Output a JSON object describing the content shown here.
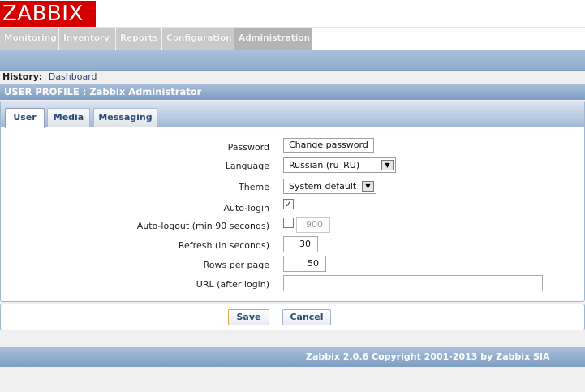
{
  "logo": "ZABBIX",
  "menu": [
    {
      "label": "Monitoring",
      "active": false
    },
    {
      "label": "Inventory",
      "active": false
    },
    {
      "label": "Reports",
      "active": false
    },
    {
      "label": "Configuration",
      "active": false
    },
    {
      "label": "Administration",
      "active": true
    }
  ],
  "history": {
    "label": "History:",
    "link": "Dashboard"
  },
  "page_header": "USER PROFILE : Zabbix Administrator",
  "tabs": [
    {
      "label": "User",
      "active": true
    },
    {
      "label": "Media",
      "active": false
    },
    {
      "label": "Messaging",
      "active": false
    }
  ],
  "form": {
    "password": {
      "label": "Password",
      "button": "Change password"
    },
    "language": {
      "label": "Language",
      "value": "Russian (ru_RU)"
    },
    "theme": {
      "label": "Theme",
      "value": "System default"
    },
    "autologin": {
      "label": "Auto-login",
      "checked": true,
      "mark": "✓"
    },
    "autologout": {
      "label": "Auto-logout (min 90 seconds)",
      "checked": false,
      "value": "900"
    },
    "refresh": {
      "label": "Refresh (in seconds)",
      "value": "30"
    },
    "rows_per_page": {
      "label": "Rows per page",
      "value": "50"
    },
    "url": {
      "label": "URL (after login)",
      "value": ""
    }
  },
  "buttons": {
    "save": "Save",
    "cancel": "Cancel"
  },
  "footer": "Zabbix 2.0.6 Copyright 2001-2013 by Zabbix SIA",
  "icons": {
    "dropdown": "chevron-down-icon"
  },
  "colors": {
    "logo_bg": "#d40000",
    "header_blue": "#7e9ec3",
    "menu_gray": "#cacaca",
    "save_border": "#e0a84b"
  }
}
